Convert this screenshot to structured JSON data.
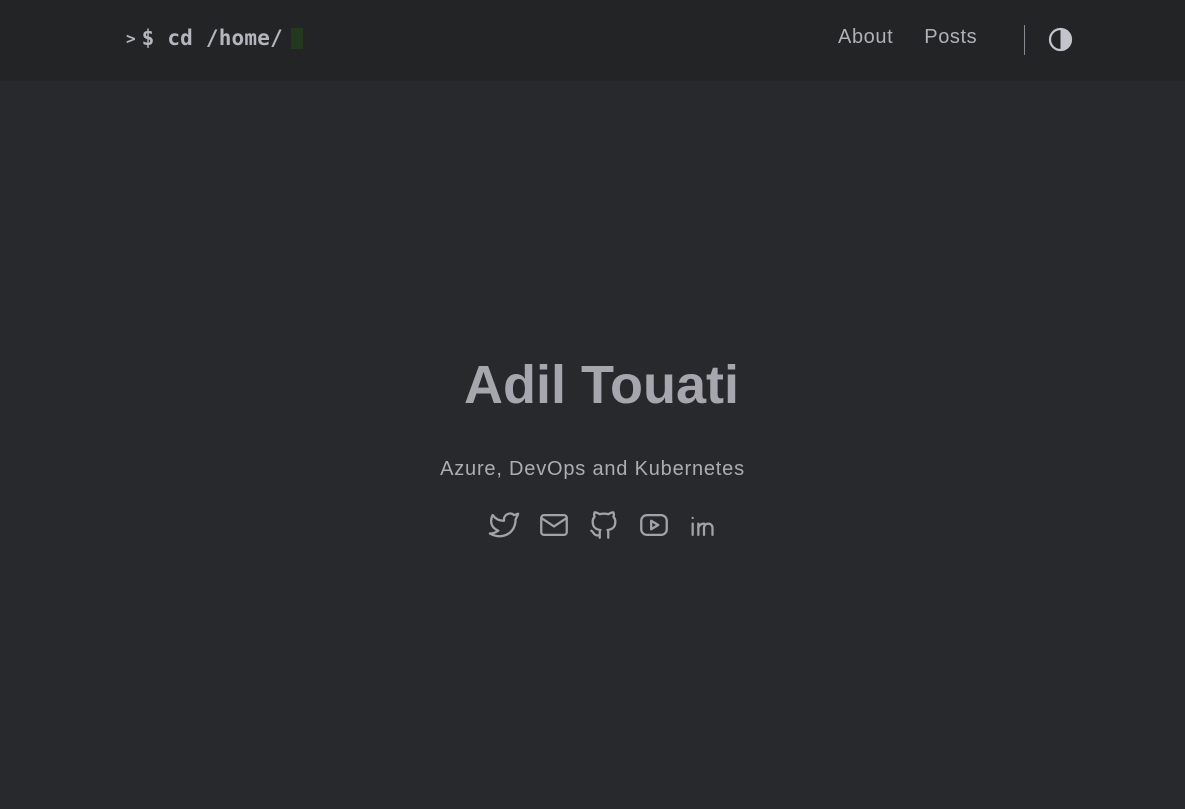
{
  "header": {
    "logo": {
      "caret": ">",
      "command": "$ cd /home/"
    },
    "nav": [
      {
        "label": "About"
      },
      {
        "label": "Posts"
      }
    ],
    "theme_toggle_icon": "contrast-icon"
  },
  "hero": {
    "name": "Adil Touati",
    "tagline": "Azure, DevOps and Kubernetes"
  },
  "socials": [
    {
      "icon": "twitter-icon"
    },
    {
      "icon": "mail-icon"
    },
    {
      "icon": "github-icon"
    },
    {
      "icon": "youtube-icon"
    },
    {
      "icon": "linkedin-icon"
    }
  ],
  "colors": {
    "background": "#28292d",
    "header_background": "#232425",
    "text": "#a7a6ae",
    "cursor": "#22391f"
  }
}
